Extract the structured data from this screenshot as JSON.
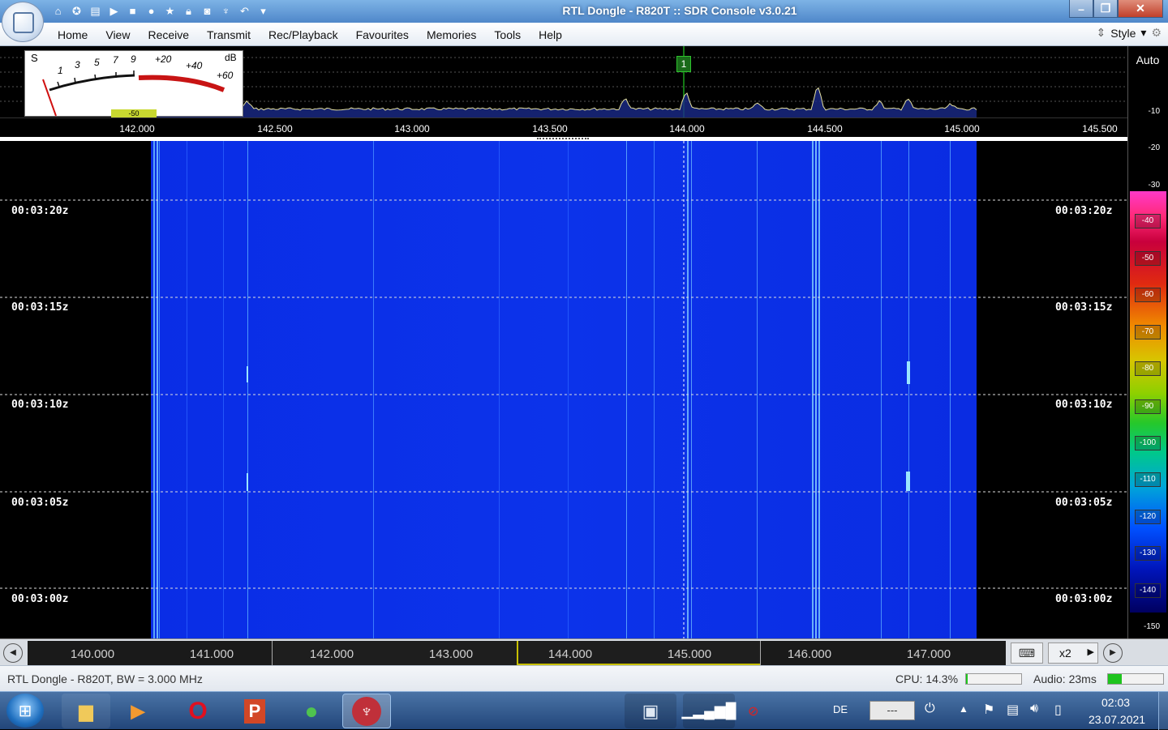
{
  "window": {
    "title": "RTL Dongle - R820T :: SDR Console v3.0.21"
  },
  "menu": [
    "Home",
    "View",
    "Receive",
    "Transmit",
    "Rec/Playback",
    "Favourites",
    "Memories",
    "Tools",
    "Help"
  ],
  "style_label": "Style",
  "auto_label": "Auto",
  "smeter": {
    "label_s": "S",
    "label_db": "dB",
    "scale": [
      "1",
      "3",
      "5",
      "7",
      "9",
      "+20",
      "+40",
      "+60"
    ],
    "level": "-50"
  },
  "vfo_marker": "1",
  "spectrum_freqs": [
    "142.000",
    "142.500",
    "143.000",
    "143.500",
    "144.000",
    "144.500",
    "145.000",
    "145.500"
  ],
  "db_scale": [
    "-10",
    "-20",
    "-30",
    "-40",
    "-50",
    "-60",
    "-70",
    "-80",
    "-90",
    "-100",
    "-110",
    "-120",
    "-130",
    "-140",
    "-150"
  ],
  "timestamps": [
    "00:03:20z",
    "00:03:15z",
    "00:03:10z",
    "00:03:05z",
    "00:03:00z"
  ],
  "band_freqs": [
    "140.000",
    "141.000",
    "142.000",
    "143.000",
    "144.000",
    "145.000",
    "146.000",
    "147.000"
  ],
  "zoom_label": "x2",
  "status": {
    "device": "RTL Dongle - R820T, BW = 3.000 MHz",
    "cpu": "CPU: 14.3%",
    "cpu_fill": 0.03,
    "audio": "Audio: 23ms",
    "audio_fill": 0.25
  },
  "taskbar": {
    "language": "DE",
    "tray_box": "---",
    "time": "02:03",
    "date": "23.07.2021"
  },
  "colors": {
    "waterfall_blue": "#0b2fe6",
    "spectrum_trace": "#e6e2a0",
    "marker_green": "#1aa01a"
  }
}
